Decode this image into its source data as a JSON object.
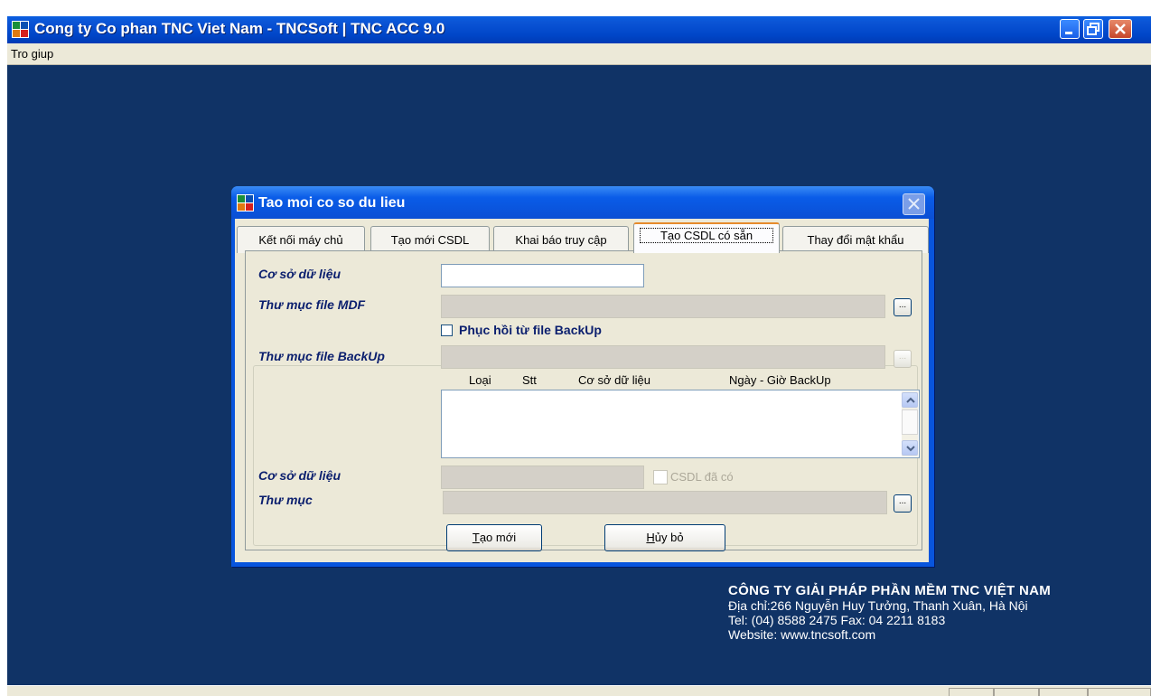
{
  "window": {
    "title": "Cong ty Co phan TNC Viet Nam - TNCSoft | TNC ACC 9.0"
  },
  "menu": {
    "items": [
      "Tro giup"
    ]
  },
  "company": {
    "name": "CÔNG TY GIẢI PHÁP PHẦN MỀM TNC VIỆT NAM",
    "address": "Địa chỉ:266 Nguyễn Huy Tưởng, Thanh Xuân, Hà Nội",
    "phone": "Tel: (04) 8588 2475 Fax: 04 2211 8183",
    "website": "Website: www.tncsoft.com"
  },
  "dialog": {
    "title": "Tao moi co so du lieu",
    "tabs": [
      {
        "label": "Kết nối máy chủ",
        "active": false
      },
      {
        "label": "Tạo mới CSDL",
        "active": false
      },
      {
        "label": "Khai báo truy cập",
        "active": false
      },
      {
        "label": "Tạo CSDL có sẵn",
        "active": true
      },
      {
        "label": "Thay đổi mật khẩu",
        "active": false
      }
    ],
    "form": {
      "database_label": "Cơ sở dữ liệu",
      "database_value": "",
      "mdf_folder_label": "Thư mục file MDF",
      "mdf_folder_value": "",
      "browse_label": "...",
      "restore_checkbox_label": "Phục hồi từ file BackUp",
      "restore_checked": false,
      "backup_folder_label": "Thư mục file BackUp",
      "backup_folder_value": "",
      "list_columns": [
        "Loại",
        "Stt",
        "Cơ sở dữ liệu",
        "Ngày - Giờ BackUp"
      ],
      "restore_db_label": "Cơ sở dữ liệu",
      "restore_db_value": "",
      "exists_checkbox_label": "CSDL đã có",
      "folder_label": "Thư mục",
      "folder_value": ""
    },
    "buttons": {
      "create_prefix": "T",
      "create_rest": "ạo mới",
      "cancel_prefix": "H",
      "cancel_rest": "ủy bỏ"
    }
  },
  "colors": {
    "desktop": "#103366",
    "titlebar": "#0046c8",
    "label_text": "#0b1f6e"
  }
}
